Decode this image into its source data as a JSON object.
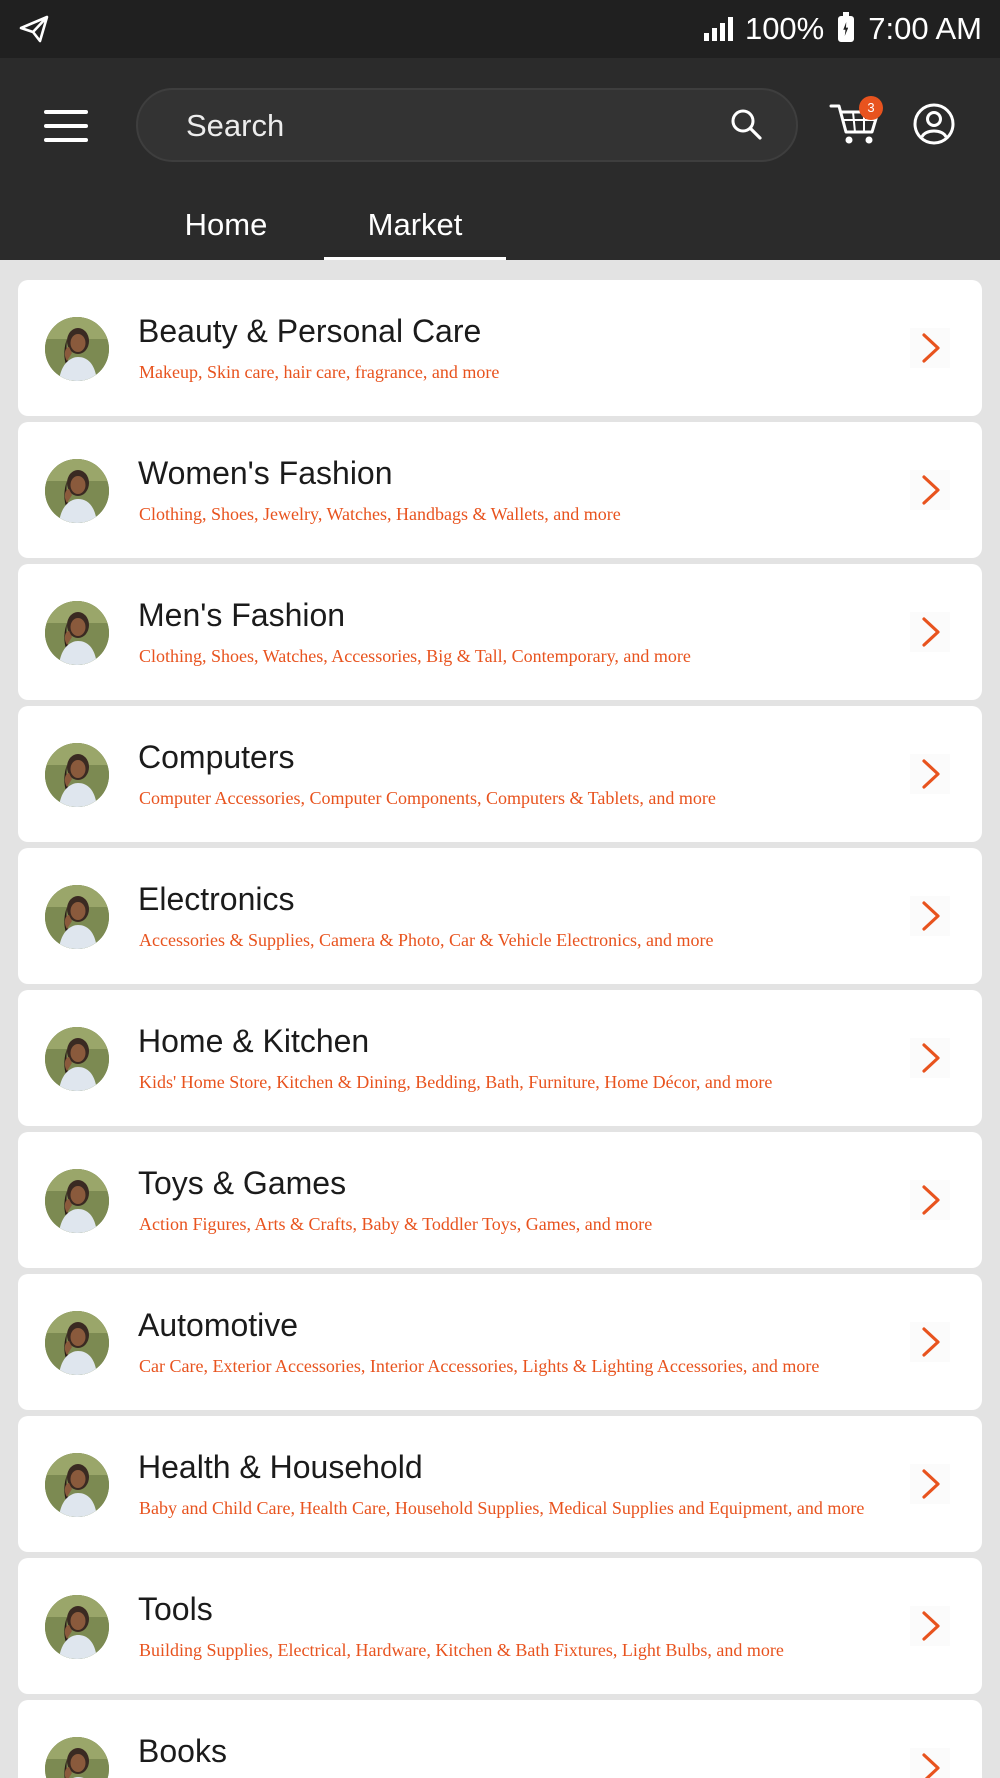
{
  "status_bar": {
    "battery": "100%",
    "time": "7:00 AM"
  },
  "header": {
    "search_placeholder": "Search",
    "cart_count": "3",
    "tabs": [
      {
        "label": "Home",
        "active": false
      },
      {
        "label": "Market",
        "active": true
      }
    ]
  },
  "colors": {
    "accent": "#e8531e",
    "header_bg": "#2b2b2b",
    "status_bg": "#202020"
  },
  "categories": [
    {
      "title": "Beauty & Personal Care",
      "subtitle": "Makeup, Skin care, hair care, fragrance, and more"
    },
    {
      "title": "Women's Fashion",
      "subtitle": "Clothing, Shoes, Jewelry, Watches, Handbags & Wallets, and more"
    },
    {
      "title": "Men's Fashion",
      "subtitle": "Clothing, Shoes, Watches, Accessories, Big & Tall, Contemporary, and more"
    },
    {
      "title": "Computers",
      "subtitle": "Computer Accessories, Computer Components, Computers & Tablets, and more"
    },
    {
      "title": "Electronics",
      "subtitle": "Accessories & Supplies, Camera & Photo, Car & Vehicle Electronics, and more"
    },
    {
      "title": "Home & Kitchen",
      "subtitle": "Kids' Home Store, Kitchen & Dining, Bedding, Bath, Furniture, Home Décor, and more"
    },
    {
      "title": "Toys & Games",
      "subtitle": "Action Figures, Arts & Crafts, Baby & Toddler Toys, Games, and more"
    },
    {
      "title": "Automotive",
      "subtitle": "Car Care, Exterior Accessories, Interior Accessories, Lights & Lighting Accessories, and more"
    },
    {
      "title": "Health & Household",
      "subtitle": "Baby and Child Care, Health Care, Household Supplies, Medical Supplies and Equipment, and more"
    },
    {
      "title": "Tools",
      "subtitle": "Building Supplies, Electrical, Hardware, Kitchen & Bath Fixtures, Light Bulbs, and more"
    },
    {
      "title": "Books",
      "subtitle": ""
    }
  ]
}
